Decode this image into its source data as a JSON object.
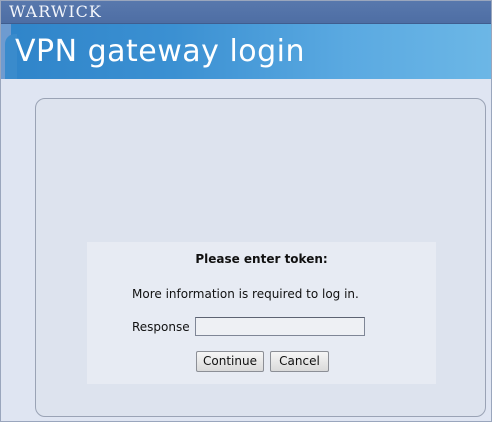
{
  "header": {
    "logo_text": "WARWICK",
    "title": "VPN gateway login"
  },
  "login": {
    "heading": "Please enter token:",
    "info": "More information is required to log in.",
    "response_label": "Response",
    "response_value": "",
    "continue_label": "Continue",
    "cancel_label": "Cancel"
  },
  "colors": {
    "top_bar": "#5878ad",
    "title_bar": "#3b90d2",
    "background": "#dfe5f2"
  }
}
